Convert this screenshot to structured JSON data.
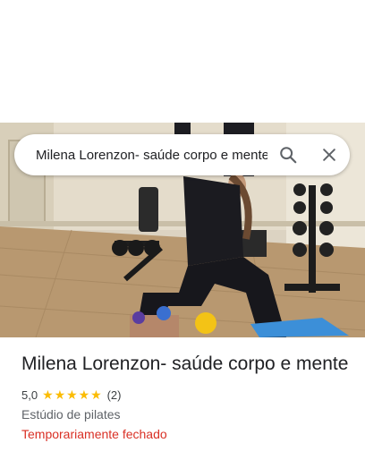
{
  "search": {
    "query": "Milena Lorenzon- saúde corpo e mente",
    "search_icon": "search-icon",
    "clear_icon": "close-icon"
  },
  "place": {
    "name": "Milena Lorenzon- saúde corpo e mente",
    "rating": "5,0",
    "stars": 5,
    "review_count": "(2)",
    "category": "Estúdio de pilates",
    "status": "Temporariamente fechado"
  },
  "colors": {
    "star": "#fbbc04",
    "status_closed": "#d93025",
    "title": "#202124"
  }
}
